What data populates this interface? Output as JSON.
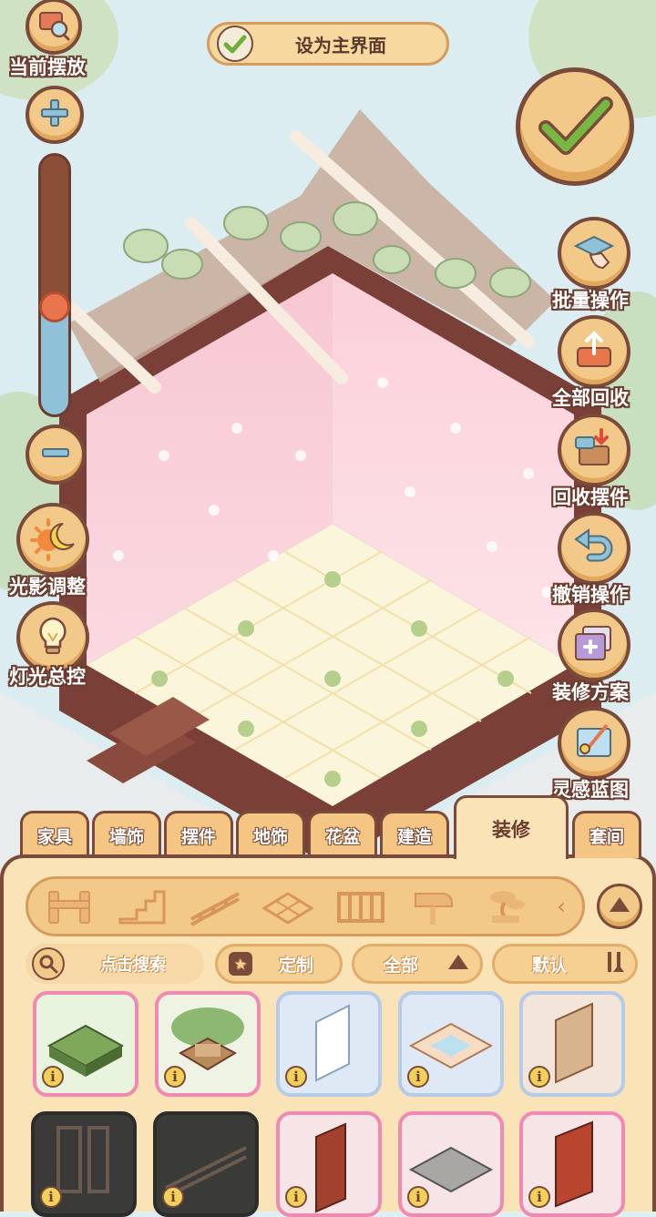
{
  "top": {
    "set_main_label": "设为主界面",
    "current_placement_label": "当前摆放"
  },
  "zoom": {
    "level": 0.33
  },
  "left_tools": [
    {
      "label": "光影调整",
      "icon": "sun-moon-icon"
    },
    {
      "label": "灯光总控",
      "icon": "lightbulb-icon"
    }
  ],
  "right_tools": [
    {
      "label": "批量操作",
      "icon": "batch-hand-icon"
    },
    {
      "label": "全部回收",
      "icon": "recycle-tray-icon"
    },
    {
      "label": "回收摆件",
      "icon": "recycle-box-icon"
    },
    {
      "label": "撤销操作",
      "icon": "undo-arrow-icon"
    },
    {
      "label": "装修方案",
      "icon": "scheme-folder-icon"
    },
    {
      "label": "灵感蓝图",
      "icon": "blueprint-icon"
    }
  ],
  "tabs": [
    {
      "label": "家具"
    },
    {
      "label": "墙饰"
    },
    {
      "label": "摆件"
    },
    {
      "label": "地饰"
    },
    {
      "label": "花盆"
    },
    {
      "label": "建造"
    },
    {
      "label": "装修",
      "active": true
    },
    {
      "label": "套间"
    }
  ],
  "subcategories": [
    "fence-icon",
    "stairs-icon",
    "railing-icon",
    "roof-tile-icon",
    "gate-fence-icon",
    "mailbox-icon",
    "bonsai-icon"
  ],
  "filters": {
    "search_placeholder": "点击搜索",
    "custom_label": "定制",
    "all_label": "全部",
    "default_label": "默认"
  },
  "info_glyph": "i",
  "colors": {
    "outline": "#7a4a3a",
    "panel": "#fbe3b8",
    "button": "#f3c98a",
    "check_green": "#6fae3d",
    "card_border_pink": "#f08ab3"
  }
}
